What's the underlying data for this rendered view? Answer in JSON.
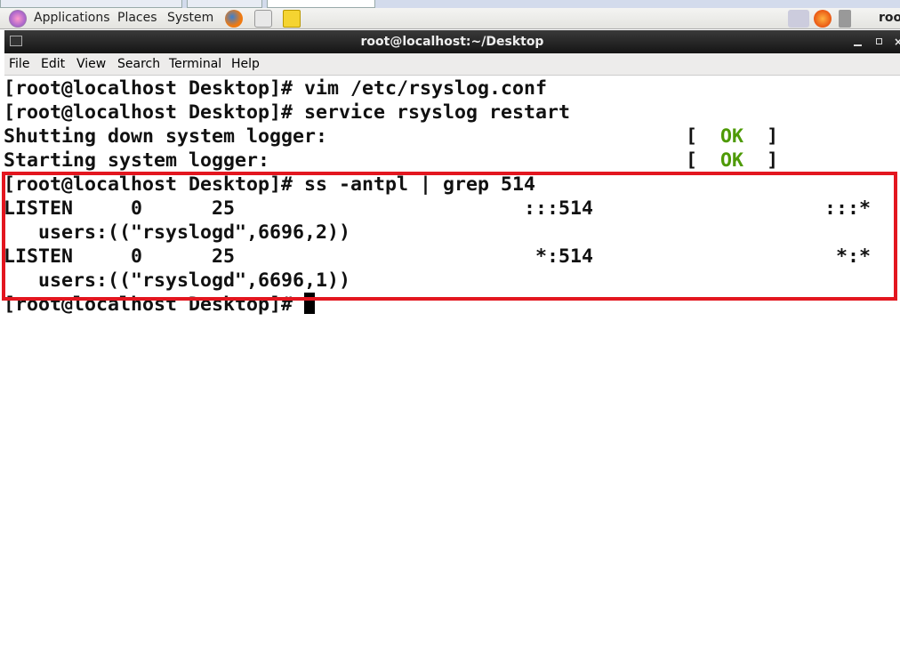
{
  "top_panel": {
    "menus": [
      "Applications",
      "Places",
      "System"
    ],
    "user": "roo"
  },
  "window": {
    "title": "root@localhost:~/Desktop"
  },
  "menubar": [
    "File",
    "Edit",
    "View",
    "Search",
    "Terminal",
    "Help"
  ],
  "terminal": {
    "lines": [
      {
        "text": "[root@localhost Desktop]# vim /etc/rsyslog.conf"
      },
      {
        "text": "[root@localhost Desktop]# service rsyslog restart"
      },
      {
        "text": "Shutting down system logger:",
        "status": "OK"
      },
      {
        "text": "Starting system logger:",
        "status": "OK"
      },
      {
        "text": "[root@localhost Desktop]# ss -antpl | grep 514"
      },
      {
        "text": "LISTEN     0      25                         :::514                    :::*"
      },
      {
        "text": "   users:((\"rsyslogd\",6696,2))"
      },
      {
        "text": "LISTEN     0      25                          *:514                     *:*"
      },
      {
        "text": "   users:((\"rsyslogd\",6696,1))"
      },
      {
        "text": "[root@localhost Desktop]# ",
        "cursor": true
      }
    ]
  },
  "colors": {
    "ok": "#4e9a06",
    "highlight": "#e3161f"
  }
}
